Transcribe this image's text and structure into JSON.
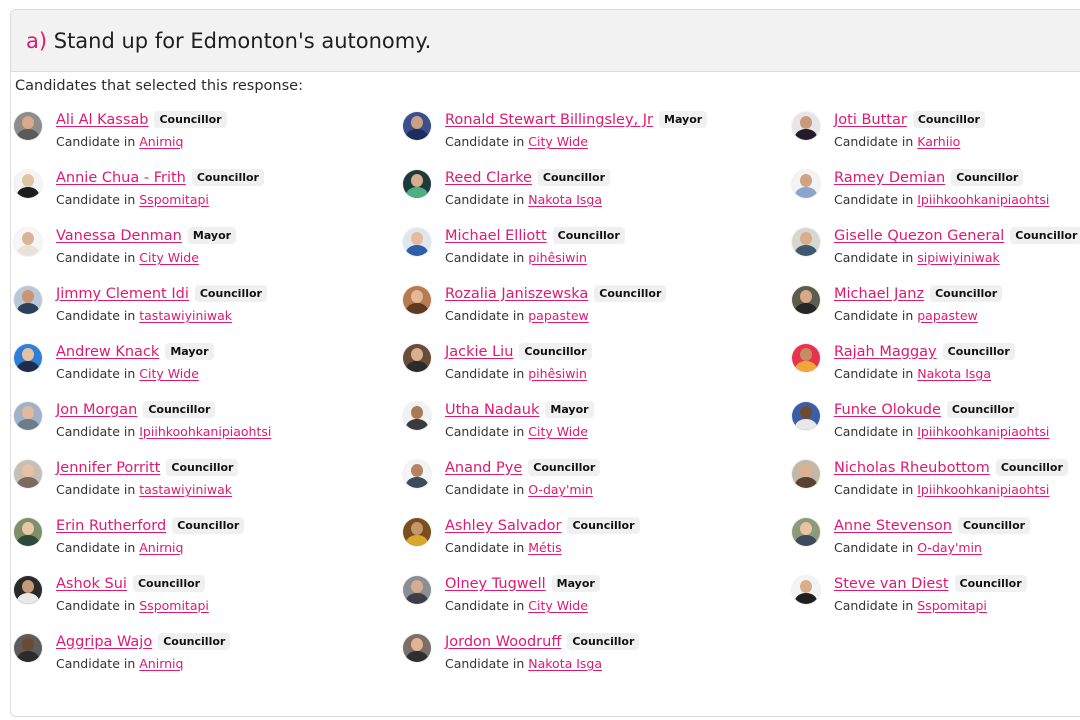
{
  "question": {
    "letter": "a)",
    "text": " Stand up for Edmonton's autonomy."
  },
  "intro": "Candidates that selected this response:",
  "candidate_prefix": "Candidate in ",
  "columns": [
    [
      {
        "name": "Ali Al Kassab",
        "role": "Councillor",
        "ward": "Anirniq",
        "av": [
          "#8d8d8d",
          "#5a5a5a",
          "#d9a98a"
        ]
      },
      {
        "name": "Annie Chua - Frith",
        "role": "Councillor",
        "ward": "Sspomitapi",
        "av": [
          "#f4f4f4",
          "#1c1c1c",
          "#e3c3a8"
        ]
      },
      {
        "name": "Vanessa Denman",
        "role": "Mayor",
        "ward": "City Wide",
        "av": [
          "#f6f6f6",
          "#e9e2d8",
          "#d8b596"
        ]
      },
      {
        "name": "Jimmy Clement Idi",
        "role": "Councillor",
        "ward": "tastawiyiniwak",
        "av": [
          "#b9c7d6",
          "#2e3f5c",
          "#c99574"
        ]
      },
      {
        "name": "Andrew Knack",
        "role": "Mayor",
        "ward": "City Wide",
        "av": [
          "#2f7fd6",
          "#1f2d4a",
          "#e7c0a0"
        ]
      },
      {
        "name": "Jon Morgan",
        "role": "Councillor",
        "ward": "Ipiihkoohkanipiaohtsi",
        "av": [
          "#9fb3c8",
          "#6d7b8c",
          "#e2b99a"
        ]
      },
      {
        "name": "Jennifer Porritt",
        "role": "Councillor",
        "ward": "tastawiyiniwak",
        "av": [
          "#c6c0b4",
          "#7a6b5c",
          "#e6c2a4"
        ]
      },
      {
        "name": "Erin Rutherford",
        "role": "Councillor",
        "ward": "Anirniq",
        "av": [
          "#7f8f6a",
          "#2d4a3a",
          "#e9c6a6"
        ]
      },
      {
        "name": "Ashok Sui",
        "role": "Councillor",
        "ward": "Sspomitapi",
        "av": [
          "#2a2a2a",
          "#e8e8e8",
          "#c49a78"
        ]
      },
      {
        "name": "Aggripa Wajo",
        "role": "Councillor",
        "ward": "Anirniq",
        "av": [
          "#5c5c5c",
          "#2b2b2b",
          "#6b4a34"
        ]
      }
    ],
    [
      {
        "name": "Ronald Stewart Billingsley, Jr",
        "role": "Mayor",
        "ward": "City Wide",
        "av": [
          "#3b4f8c",
          "#1e2d5e",
          "#c9a183"
        ]
      },
      {
        "name": "Reed Clarke",
        "role": "Councillor",
        "ward": "Nakota Isga",
        "av": [
          "#1e3b3b",
          "#4caf82",
          "#d6ad8d"
        ]
      },
      {
        "name": "Michael Elliott",
        "role": "Councillor",
        "ward": "pihêsiwin",
        "av": [
          "#dfe6ee",
          "#2f5da8",
          "#e5bb9b"
        ]
      },
      {
        "name": "Rozalia Janiszewska",
        "role": "Councillor",
        "ward": "papastew",
        "av": [
          "#b97a4f",
          "#5e3a22",
          "#e3b896"
        ]
      },
      {
        "name": "Jackie Liu",
        "role": "Councillor",
        "ward": "pihêsiwin",
        "av": [
          "#6a4c3a",
          "#2b2b2b",
          "#d9b08e"
        ]
      },
      {
        "name": "Utha Nadauk",
        "role": "Mayor",
        "ward": "City Wide",
        "av": [
          "#f2f2f2",
          "#3a3a3a",
          "#a77a58"
        ]
      },
      {
        "name": "Anand Pye",
        "role": "Councillor",
        "ward": "O-day'min",
        "av": [
          "#f4f4f4",
          "#3c4b5e",
          "#b58463"
        ]
      },
      {
        "name": "Ashley Salvador",
        "role": "Councillor",
        "ward": "Métis",
        "av": [
          "#7a4e1f",
          "#d9a72c",
          "#c8946c"
        ]
      },
      {
        "name": "Olney Tugwell",
        "role": "Mayor",
        "ward": "City Wide",
        "av": [
          "#8a8f94",
          "#3c3f45",
          "#d3ad8e"
        ]
      },
      {
        "name": "Jordon Woodruff",
        "role": "Councillor",
        "ward": "Nakota Isga",
        "av": [
          "#7b6f68",
          "#2f2f2f",
          "#e0b593"
        ]
      }
    ],
    [
      {
        "name": "Joti Buttar",
        "role": "Councillor",
        "ward": "Karhiio",
        "av": [
          "#e9e4ea",
          "#231b2a",
          "#c99a7a"
        ]
      },
      {
        "name": "Ramey Demian",
        "role": "Councillor",
        "ward": "Ipiihkoohkanipiaohtsi",
        "av": [
          "#f3f3f3",
          "#8aa5c9",
          "#cfa384"
        ]
      },
      {
        "name": "Giselle Quezon General",
        "role": "Councillor",
        "ward": "sipiwiyiniwak",
        "av": [
          "#d7d7cf",
          "#3f5870",
          "#d7ae8c"
        ]
      },
      {
        "name": "Michael Janz",
        "role": "Councillor",
        "ward": "papastew",
        "av": [
          "#5d5d4f",
          "#262626",
          "#d6a987"
        ]
      },
      {
        "name": "Rajah Maggay",
        "role": "Councillor",
        "ward": "Nakota Isga",
        "av": [
          "#e8334f",
          "#f3a53a",
          "#c48d65"
        ]
      },
      {
        "name": "Funke Olokude",
        "role": "Councillor",
        "ward": "Ipiihkoohkanipiaohtsi",
        "av": [
          "#3c5da8",
          "#e8e8e8",
          "#6e4a32"
        ]
      },
      {
        "name": "Nicholas Rheubottom",
        "role": "Councillor",
        "ward": "Ipiihkoohkanipiaohtsi",
        "av": [
          "#c3b8a8",
          "#5a4030",
          "#dcb192"
        ]
      },
      {
        "name": "Anne Stevenson",
        "role": "Councillor",
        "ward": "O-day'min",
        "av": [
          "#8c9a7a",
          "#3c4a5c",
          "#e8c3a3"
        ]
      },
      {
        "name": "Steve van Diest",
        "role": "Councillor",
        "ward": "Sspomitapi",
        "av": [
          "#f3f3f3",
          "#1f1f1f",
          "#d9ae8c"
        ]
      }
    ]
  ]
}
